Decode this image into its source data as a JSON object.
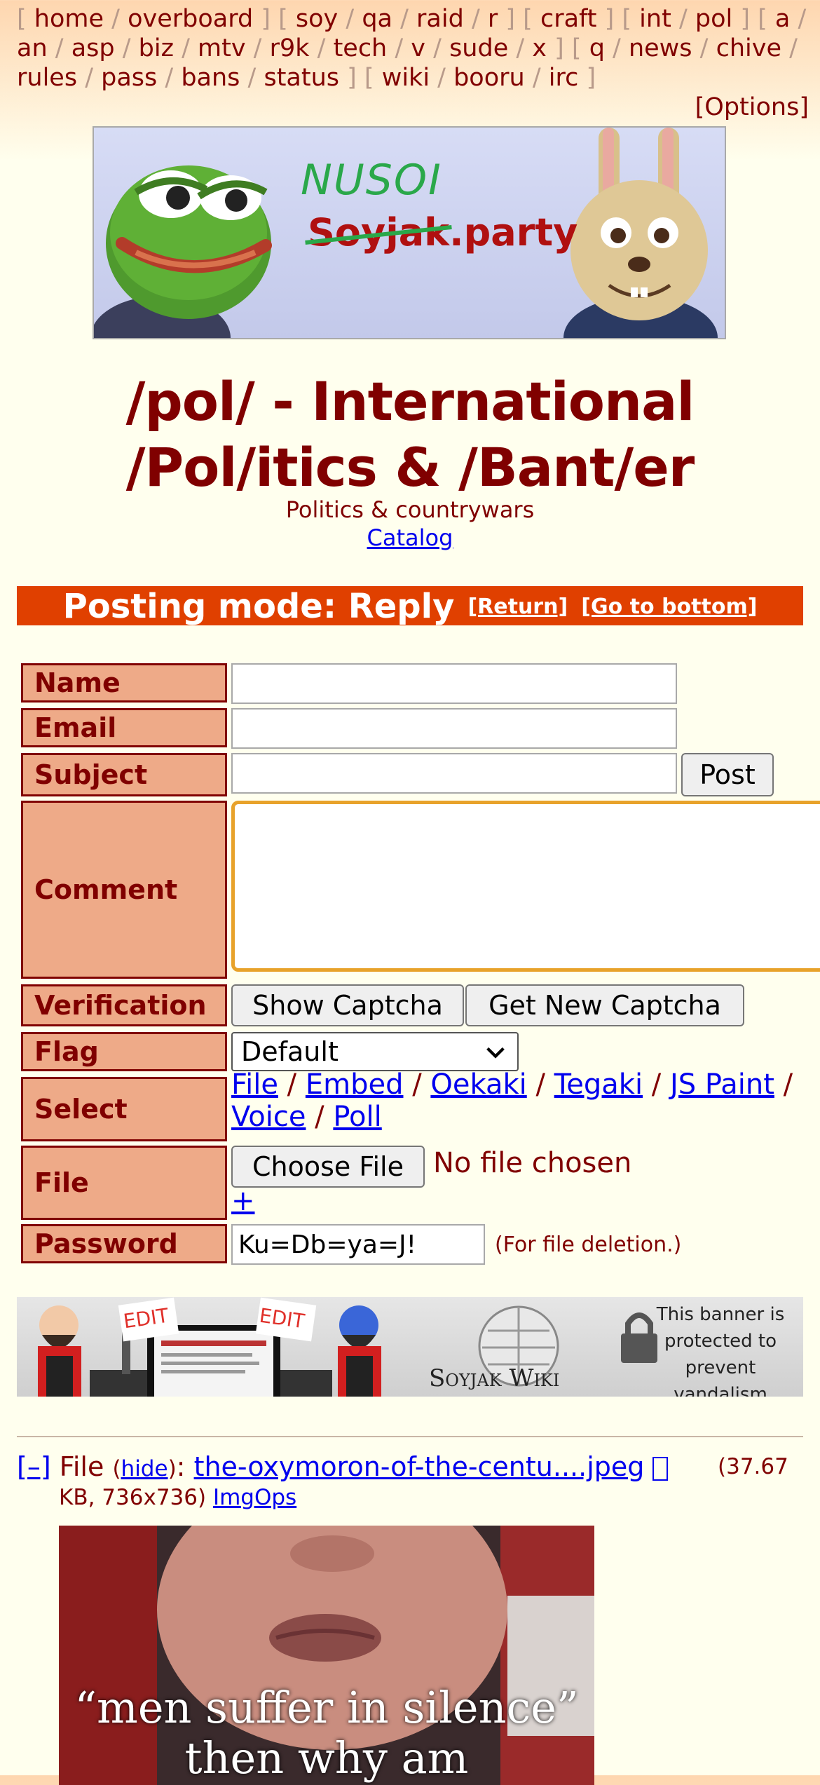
{
  "boardlist": {
    "groups": [
      [
        "home",
        "overboard"
      ],
      [
        "soy",
        "qa",
        "raid",
        "r"
      ],
      [
        "craft"
      ],
      [
        "int",
        "pol"
      ],
      [
        "a",
        "an",
        "asp",
        "biz",
        "mtv",
        "r9k",
        "tech",
        "v",
        "sude",
        "x"
      ],
      [
        "q",
        "news",
        "chive",
        "rules",
        "pass",
        "bans",
        "status"
      ],
      [
        "wiki",
        "booru",
        "irc"
      ]
    ],
    "options": "[Options]"
  },
  "banner": {
    "top_text": "NUSOI",
    "struck_text": "Soyjak",
    "suffix_text": ".party"
  },
  "board": {
    "title": "/pol/ - International /Pol/itics & /Bant/er",
    "subtitle": "Politics & countrywars",
    "catalog": "Catalog"
  },
  "posting_mode": {
    "text": "Posting mode: Reply",
    "return": "[Return]",
    "go_bottom": "[Go to bottom]"
  },
  "form": {
    "name_label": "Name",
    "email_label": "Email",
    "subject_label": "Subject",
    "post_button": "Post",
    "comment_label": "Comment",
    "verification_label": "Verification",
    "show_captcha": "Show Captcha",
    "new_captcha": "Get New Captcha",
    "flag_label": "Flag",
    "flag_value": "Default",
    "select_label": "Select",
    "select_links": [
      "File",
      "Embed",
      "Oekaki",
      "Tegaki",
      "JS Paint",
      "Voice",
      "Poll"
    ],
    "file_label": "File",
    "choose_file": "Choose File",
    "no_file": "No file chosen",
    "plus": "+",
    "password_label": "Password",
    "password_value": "Ku=Db=ya=J!",
    "password_hint": "(For file deletion.)"
  },
  "wiki_banner": {
    "edit": "EDIT",
    "wiki_text": "Soyjak Wiki",
    "protected_text": "This banner is protected to prevent vandalism"
  },
  "post": {
    "collapse": "[–]",
    "file_word": "File",
    "hide": "hide",
    "filename": "the-oxymoron-of-the-centu....jpeg",
    "download_icon": "download-icon",
    "size": "(37.67 KB, 736x736)",
    "imgops": "ImgOps",
    "image_caption": "“men suffer in silence” then why am"
  },
  "colors": {
    "maroon": "#800000",
    "label_bg": "#eeaa88",
    "posting_bar": "#e04000",
    "link": "#0000ee",
    "background": "#ffffee"
  }
}
